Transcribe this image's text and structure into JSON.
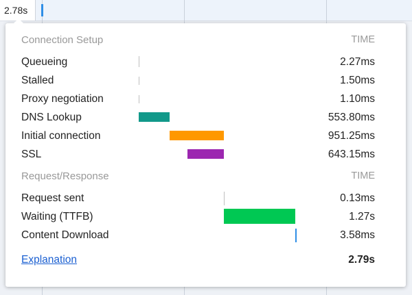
{
  "duration_cell": {
    "label": "2.78s"
  },
  "popover": {
    "connection_setup": {
      "title": "Connection Setup",
      "time_header": "TIME",
      "rows": [
        {
          "label": "Queueing",
          "value": "2.27ms"
        },
        {
          "label": "Stalled",
          "value": "1.50ms"
        },
        {
          "label": "Proxy negotiation",
          "value": "1.10ms"
        },
        {
          "label": "DNS Lookup",
          "value": "553.80ms"
        },
        {
          "label": "Initial connection",
          "value": "951.25ms"
        },
        {
          "label": "SSL",
          "value": "643.15ms"
        }
      ]
    },
    "request_response": {
      "title": "Request/Response",
      "time_header": "TIME",
      "rows": [
        {
          "label": "Request sent",
          "value": "0.13ms"
        },
        {
          "label": "Waiting (TTFB)",
          "value": "1.27s"
        },
        {
          "label": "Content Download",
          "value": "3.58ms"
        }
      ]
    },
    "footer": {
      "explanation_link": "Explanation",
      "total": "2.79s"
    }
  },
  "colors": {
    "dns": "#12998a",
    "initial_connection": "#ff9800",
    "ssl": "#9c27b0",
    "waiting": "#00c853",
    "download_tick": "#2f8ee6",
    "link": "#1a5fd1"
  }
}
